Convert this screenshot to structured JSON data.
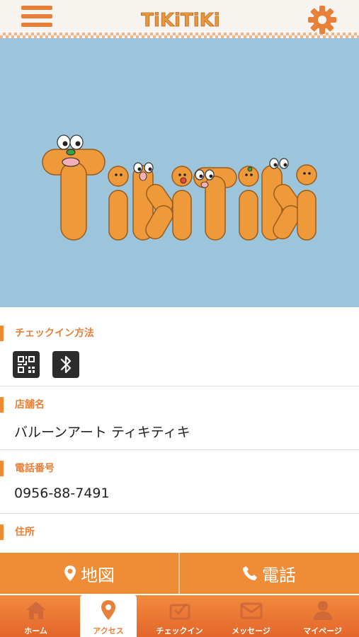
{
  "header": {
    "logo_text": "TiKiTiKi",
    "menu_icon": "hamburger-icon",
    "settings_icon": "gear-icon"
  },
  "hero": {
    "logo_text": "TiKiTiKi",
    "background": "#9cc5dc"
  },
  "sections": {
    "checkin": {
      "label": "チェックイン方法",
      "icons": [
        "qr-code-icon",
        "bluetooth-icon"
      ]
    },
    "store": {
      "label": "店舗名",
      "value": "バルーンアート ティキティキ"
    },
    "phone": {
      "label": "電話番号",
      "value": "0956-88-7491"
    },
    "address": {
      "label": "住所"
    }
  },
  "actions": {
    "map_label": "地図",
    "tel_label": "電話"
  },
  "tabs": [
    {
      "label": "ホーム",
      "icon": "home-icon",
      "active": false
    },
    {
      "label": "アクセス",
      "icon": "map-pin-icon",
      "active": true
    },
    {
      "label": "チェックイン",
      "icon": "checkin-icon",
      "active": false
    },
    {
      "label": "メッセージ",
      "icon": "mail-icon",
      "active": false
    },
    {
      "label": "マイページ",
      "icon": "user-icon",
      "active": false
    }
  ],
  "colors": {
    "accent": "#ee8d36",
    "label": "#e8803a",
    "hero": "#9cc5dc"
  }
}
